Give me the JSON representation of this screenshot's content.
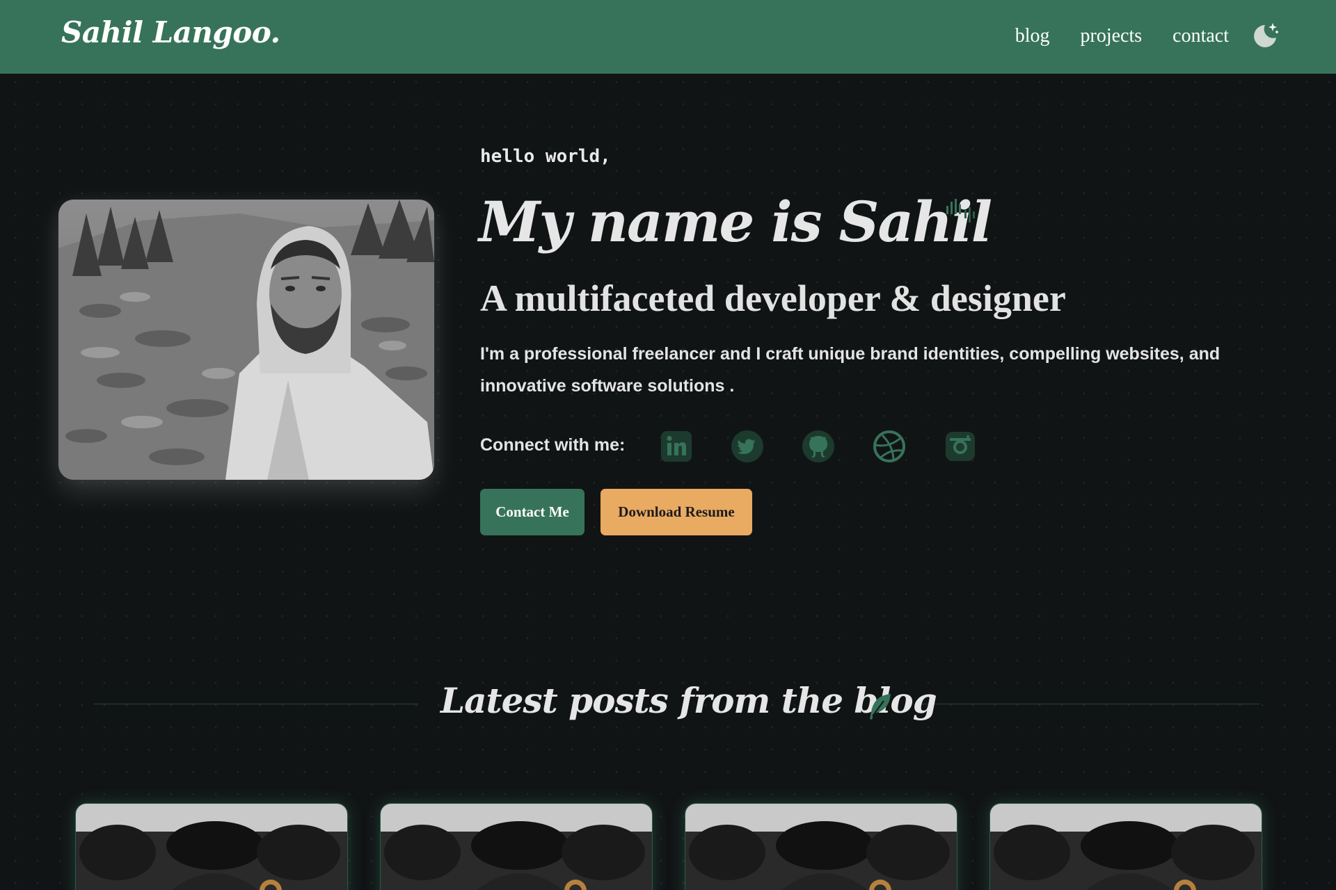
{
  "nav": {
    "brand": "Sahil Langoo.",
    "links": [
      "blog",
      "projects",
      "contact"
    ],
    "theme_icon": "moon-stars-icon"
  },
  "hero": {
    "greeting": "hello world,",
    "title": "My name is Sahil",
    "subtitle": "A multifaceted developer & designer",
    "description": "I'm a professional freelancer and I craft unique brand identities, compelling websites, and innovative software solutions  .",
    "connect_label": "Connect with me:",
    "socials": [
      "linkedin-icon",
      "twitter-icon",
      "github-icon",
      "dribbble-icon",
      "instagram-icon"
    ],
    "buttons": {
      "contact": "Contact Me",
      "resume": "Download Resume"
    }
  },
  "blog": {
    "heading": "Latest posts from the blog",
    "heading_icon": "feather-icon",
    "cards_count": 4
  },
  "colors": {
    "brand_green": "#36735a",
    "accent_orange": "#e9aa61",
    "background": "#111415"
  }
}
